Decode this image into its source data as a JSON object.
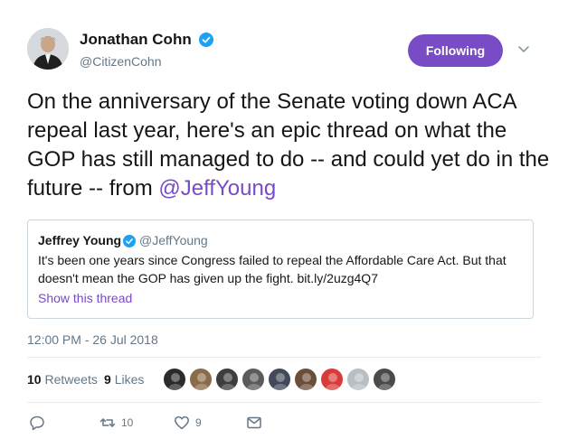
{
  "author": {
    "name": "Jonathan Cohn",
    "handle": "@CitizenCohn",
    "verified": true,
    "avatar_icon": "profile-photo"
  },
  "follow_button": {
    "label": "Following",
    "color": "#794bc4"
  },
  "tweet": {
    "text_before": "On the anniversary of the Senate voting down ACA repeal last year, here's an epic thread on what the GOP has still managed to do -- and could yet do in the future -- from ",
    "mention": "@JeffYoung"
  },
  "quoted_tweet": {
    "name": "Jeffrey Young",
    "handle": "@JeffYoung",
    "verified": true,
    "text": "It's been one years since Congress failed to repeal the Affordable Care Act. But that doesn't mean the GOP has given up the fight. bit.ly/2uzg4Q7",
    "show_thread": "Show this thread"
  },
  "timestamp": "12:00 PM - 26 Jul 2018",
  "stats": {
    "retweets_count": "10",
    "retweets_label": "Retweets",
    "likes_count": "9",
    "likes_label": "Likes",
    "liker_avatar_colors": [
      "#2b2b2b",
      "#8a6b4a",
      "#3d3d3d",
      "#5b5b5b",
      "#404a5a",
      "#6a4e3a",
      "#d93a3a",
      "#b8bec4",
      "#4a4a4a"
    ]
  },
  "actions": {
    "reply_icon": "reply-icon",
    "retweet_icon": "retweet-icon",
    "retweet_count": "10",
    "like_icon": "heart-icon",
    "like_count": "9",
    "dm_icon": "envelope-icon"
  },
  "colors": {
    "accent": "#794bc4",
    "verified": "#1da1f2",
    "secondary_text": "#657786"
  }
}
